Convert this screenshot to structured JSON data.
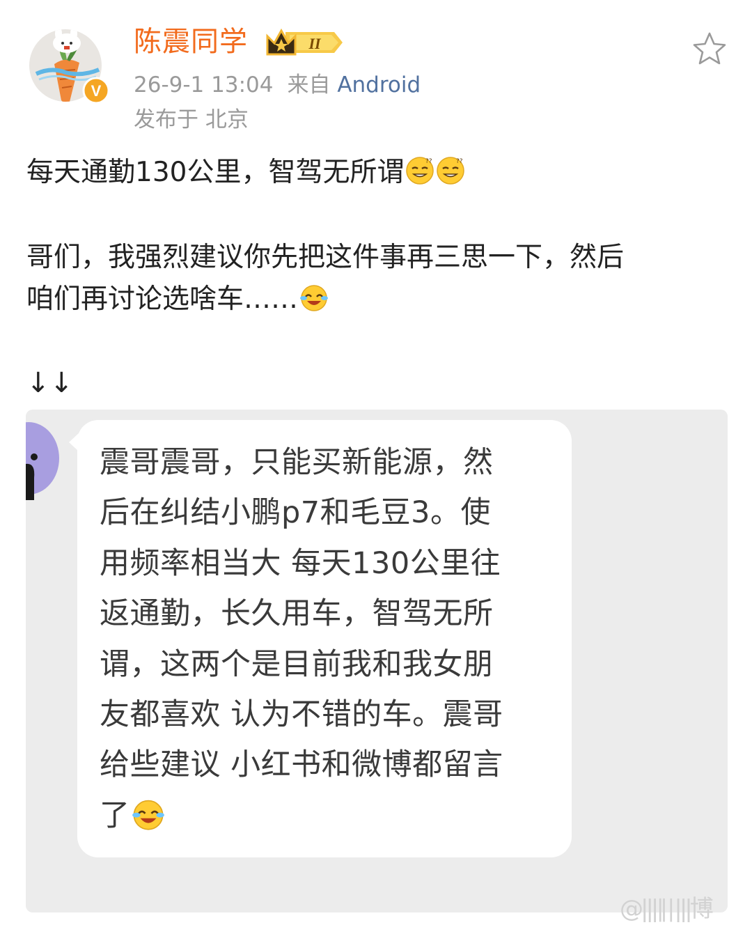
{
  "post": {
    "author": {
      "name": "陈震同学",
      "verified_badge": "V",
      "level_badge": "II"
    },
    "timestamp": "26-9-1 13:04",
    "source_prefix": "来自",
    "source_app": "Android",
    "location": "发布于 北京",
    "favorite_icon": "star-outline-icon",
    "paragraphs": [
      {
        "text": "每天通勤130公里，智驾无所谓",
        "emoji_after": [
          "smirk-emoji",
          "smirk-emoji"
        ]
      },
      {
        "text": "哥们，我强烈建议你先把这件事再三思一下，然后"
      },
      {
        "text": "咱们再讨论选啥车……",
        "emoji_after": [
          "laugh-cry-emoji"
        ]
      },
      {
        "text": "↓↓"
      }
    ]
  },
  "quoted_chat": {
    "lines": [
      "震哥震哥，只能买新能源，然",
      "后在纠结小鹏p7和毛豆3。使",
      "用频率相当大 每天130公里往",
      "返通勤，长久用车，智驾无所",
      "谓，这两个是目前我和我女朋",
      "友都喜欢 认为不错的车。震哥",
      "给些建议 小红书和微博都留言",
      "了"
    ],
    "last_line_emoji": "laugh-cry-emoji"
  },
  "colors": {
    "username": "#f26b1d",
    "meta": "#9a9a9a",
    "source_link": "#51719f",
    "body_text": "#222222",
    "chat_bg": "#ececec",
    "bubble_bg": "#ffffff",
    "verified_badge": "#f5a623"
  },
  "watermark": "@|||∥∣|||博"
}
